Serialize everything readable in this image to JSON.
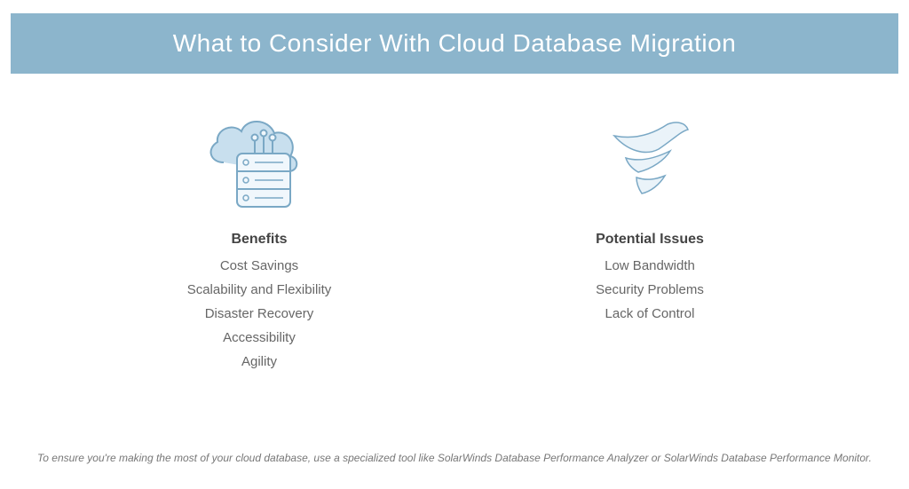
{
  "header": {
    "title": "What to Consider With Cloud Database Migration"
  },
  "columns": {
    "benefits": {
      "icon": "cloud-server-icon",
      "title": "Benefits",
      "items": [
        "Cost Savings",
        "Scalability and Flexibility",
        "Disaster Recovery",
        "Accessibility",
        "Agility"
      ]
    },
    "issues": {
      "icon": "wave-icon",
      "title": "Potential Issues",
      "items": [
        "Low Bandwidth",
        "Security Problems",
        "Lack of Control"
      ]
    }
  },
  "footer": {
    "note": "To ensure you're making the most of your cloud database, use a specialized tool like SolarWinds Database Performance Analyzer or SolarWinds Database Performance Monitor."
  },
  "colors": {
    "headerBg": "#8cb5cc",
    "iconFill": "#d7e9f5",
    "iconStroke": "#7aa8c5",
    "bodyText": "#666",
    "titleText": "#444"
  }
}
